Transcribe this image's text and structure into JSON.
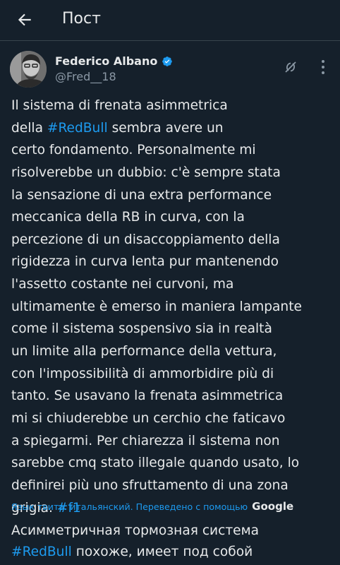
{
  "header": {
    "title": "Пост"
  },
  "author": {
    "name": "Federico Albano",
    "handle": "@Fred__18"
  },
  "tweet": {
    "lines": [
      [
        {
          "t": "Il sistema di frenata asimmetrica"
        }
      ],
      [
        {
          "t": "della "
        },
        {
          "t": "#RedBull",
          "tag": true
        },
        {
          "t": " sembra avere un"
        }
      ],
      [
        {
          "t": "certo fondamento. Personalmente mi"
        }
      ],
      [
        {
          "t": "risolverebbe un dubbio: c'è sempre stata"
        }
      ],
      [
        {
          "t": "la sensazione di una extra performance"
        }
      ],
      [
        {
          "t": "meccanica della RB in curva, con la"
        }
      ],
      [
        {
          "t": "percezione di un disaccoppiamento della"
        }
      ],
      [
        {
          "t": "rigidezza in curva lenta pur mantenendo"
        }
      ],
      [
        {
          "t": "l'assetto costante nei curvoni, ma"
        }
      ],
      [
        {
          "t": "ultimamente è emerso in maniera lampante"
        }
      ],
      [
        {
          "t": "come il sistema sospensivo sia in realtà"
        }
      ],
      [
        {
          "t": "un limite alla performance della vettura,"
        }
      ],
      [
        {
          "t": "con l'impossibilità di ammorbidire più di"
        }
      ],
      [
        {
          "t": "tanto. Se usavano la frenata asimmetrica"
        }
      ],
      [
        {
          "t": "mi si chiuderebbe un cerchio che faticavo"
        }
      ],
      [
        {
          "t": "a spiegarmi. Per chiarezza il sistema non"
        }
      ],
      [
        {
          "t": "sarebbe cmq stato illegale quando usato, lo"
        }
      ],
      [
        {
          "t": "definirei più uno sfruttamento di una zona"
        }
      ],
      [
        {
          "t": "grigia. "
        },
        {
          "t": "#f1",
          "tag": true
        }
      ]
    ]
  },
  "translation_bar": {
    "text": "Язык твита: итальянский. Переведено с помощью",
    "provider": "Google"
  },
  "translation": {
    "lines": [
      [
        {
          "t": "Асимметричная тормозная система"
        }
      ],
      [
        {
          "t": "#RedBull",
          "tag": true
        },
        {
          "t": " похоже, имеет под собой"
        }
      ]
    ]
  },
  "colors": {
    "background": "#15202b",
    "text": "#e7e9ea",
    "secondary": "#8b98a5",
    "accent": "#1d9bf0"
  },
  "icons": {
    "back": "arrow-left-icon",
    "verified": "verified-badge-icon",
    "grok": "grok-icon",
    "more": "more-vertical-icon"
  }
}
